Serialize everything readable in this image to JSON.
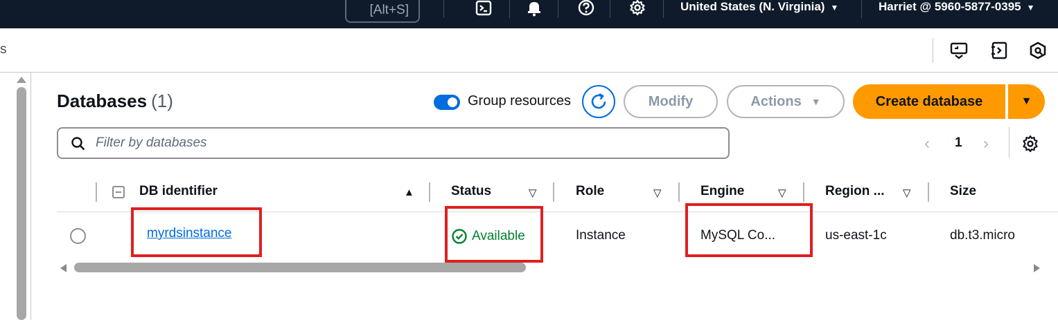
{
  "topbar": {
    "search_shortcut": "[Alt+S]",
    "icons": [
      "cloudshell-icon",
      "bell-icon",
      "help-icon",
      "gear-icon"
    ],
    "region": "United States (N. Virginia)",
    "account": "Harriet @ 5960-5877-0395"
  },
  "subbar": {
    "breadcrumb_fragment": "s",
    "icons": [
      "screen-share-icon",
      "notebook-icon",
      "hexagon-icon"
    ]
  },
  "panel": {
    "title": "Databases",
    "count": "(1)",
    "group_toggle_label": "Group resources",
    "group_toggle_on": true,
    "modify_label": "Modify",
    "actions_label": "Actions",
    "create_label": "Create database",
    "filter_placeholder": "Filter by databases",
    "page_number": "1"
  },
  "table": {
    "columns": [
      "DB identifier",
      "Status",
      "Role",
      "Engine",
      "Region ...",
      "Size"
    ],
    "rows": [
      {
        "db_identifier": "myrdsinstance",
        "status": "Available",
        "role": "Instance",
        "engine": "MySQL Co...",
        "region": "us-east-1c",
        "size": "db.t3.micro"
      }
    ]
  },
  "colors": {
    "topbar_bg": "#0f1b2a",
    "primary_button": "#ff9900",
    "link": "#006ce0",
    "status_available": "#00802f",
    "highlight_box": "#e01f1f"
  }
}
